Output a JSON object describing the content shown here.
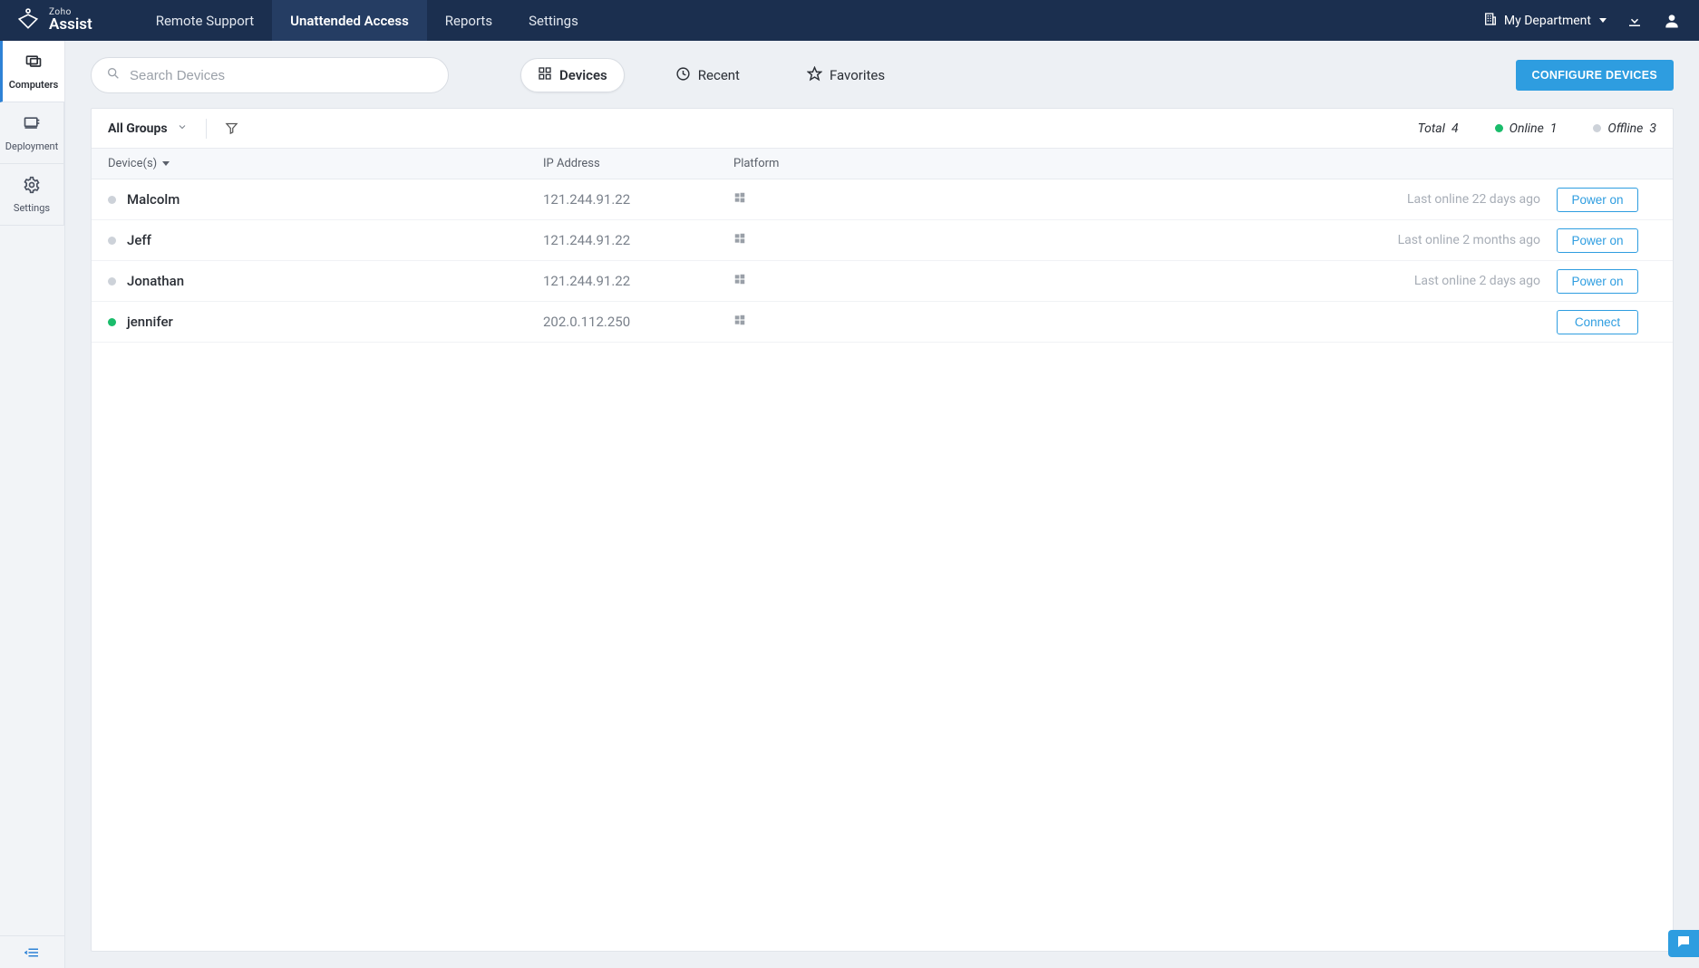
{
  "brand": {
    "top": "Zoho",
    "bottom": "Assist"
  },
  "topnav": {
    "remote_support": "Remote Support",
    "unattended_access": "Unattended Access",
    "reports": "Reports",
    "settings": "Settings"
  },
  "department": "My Department",
  "sidebar": {
    "computers": "Computers",
    "deployment": "Deployment",
    "settings": "Settings"
  },
  "toolbar": {
    "search_placeholder": "Search Devices",
    "seg_devices": "Devices",
    "seg_recent": "Recent",
    "seg_favorites": "Favorites",
    "configure": "CONFIGURE DEVICES"
  },
  "panel": {
    "group_label": "All Groups",
    "total_label": "Total",
    "total_value": "4",
    "online_label": "Online",
    "online_value": "1",
    "offline_label": "Offline",
    "offline_value": "3"
  },
  "columns": {
    "device": "Device(s)",
    "ip": "IP Address",
    "platform": "Platform"
  },
  "actions": {
    "power_on": "Power on",
    "connect": "Connect"
  },
  "devices": [
    {
      "name": "Malcolm",
      "ip": "121.244.91.22",
      "online": false,
      "last": "Last online 22 days ago",
      "action": "power_on"
    },
    {
      "name": "Jeff",
      "ip": "121.244.91.22",
      "online": false,
      "last": "Last online 2 months ago",
      "action": "power_on"
    },
    {
      "name": "Jonathan",
      "ip": "121.244.91.22",
      "online": false,
      "last": "Last online 2 days ago",
      "action": "power_on"
    },
    {
      "name": "jennifer",
      "ip": "202.0.112.250",
      "online": true,
      "last": "",
      "action": "connect"
    }
  ]
}
